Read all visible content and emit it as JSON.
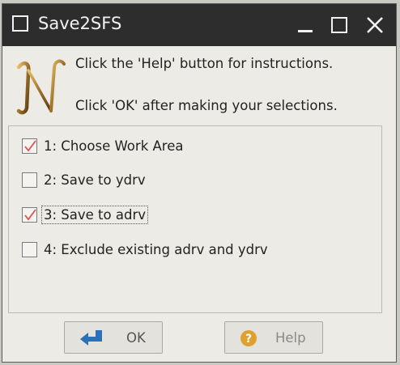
{
  "window": {
    "title": "Save2SFS"
  },
  "header": {
    "logo_letter": "N",
    "line1": "Click the 'Help' button for instructions.",
    "line2": "Click 'OK' after making your selections."
  },
  "options": [
    {
      "label": "1: Choose Work Area",
      "checked": true
    },
    {
      "label": "2: Save to ydrv",
      "checked": false
    },
    {
      "label": "3: Save to adrv",
      "checked": true,
      "focused": true
    },
    {
      "label": "4: Exclude existing adrv and ydrv",
      "checked": false
    }
  ],
  "buttons": {
    "ok": {
      "label": "OK",
      "icon": "enter-arrow-icon"
    },
    "help": {
      "label": "Help",
      "icon": "help-icon",
      "disabled": true
    }
  },
  "colors": {
    "titlebar": "#2d2d2d",
    "check_mark": "#d9534f",
    "ok_icon": "#2d6fb8",
    "help_icon": "#e0a030"
  }
}
